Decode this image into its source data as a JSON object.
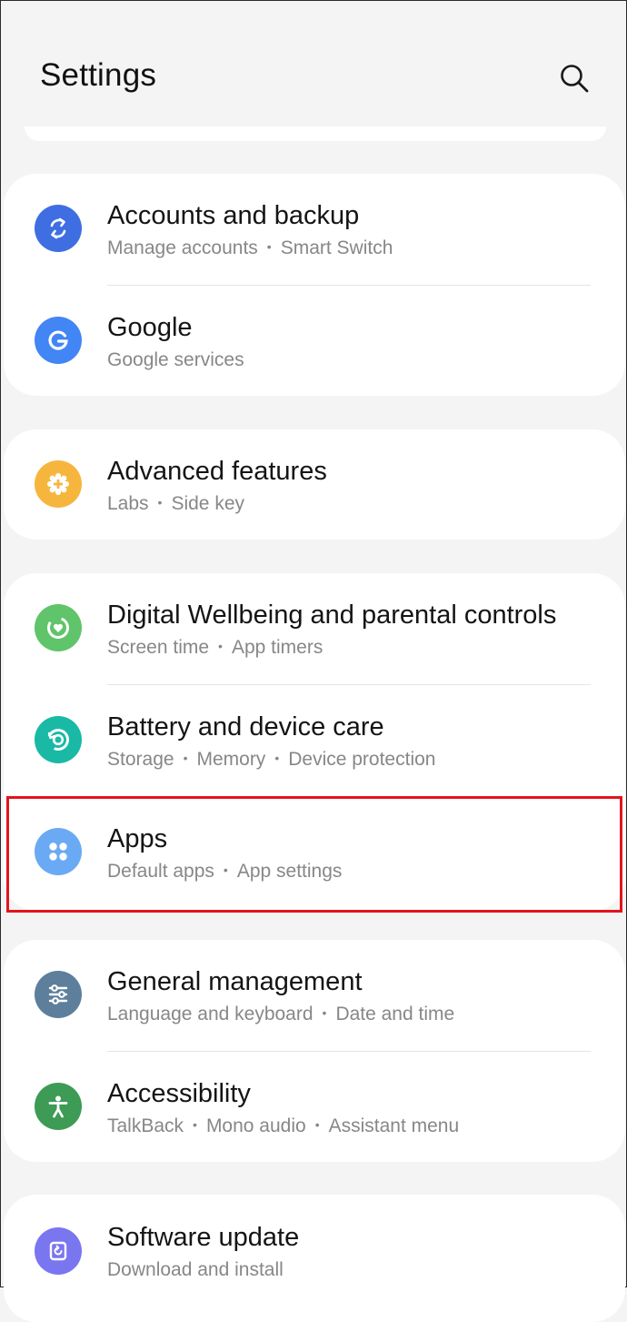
{
  "header": {
    "title": "Settings",
    "search_icon": "search-icon"
  },
  "groups": [
    {
      "items": [
        {
          "title": "Accounts and backup",
          "sub": [
            "Manage accounts",
            "Smart Switch"
          ],
          "icon": "sync-icon",
          "color": "#3f6ee2"
        },
        {
          "title": "Google",
          "sub": [
            "Google services"
          ],
          "icon": "google-g-icon",
          "color": "#4285f4"
        }
      ]
    },
    {
      "items": [
        {
          "title": "Advanced features",
          "sub": [
            "Labs",
            "Side key"
          ],
          "icon": "gear-plus-icon",
          "color": "#f6b63e"
        }
      ]
    },
    {
      "items": [
        {
          "title": "Digital Wellbeing and parental controls",
          "sub": [
            "Screen time",
            "App timers"
          ],
          "icon": "wellbeing-heart-icon",
          "color": "#5fc46a"
        },
        {
          "title": "Battery and device care",
          "sub": [
            "Storage",
            "Memory",
            "Device protection"
          ],
          "icon": "device-care-icon",
          "color": "#19b9a6"
        },
        {
          "title": "Apps",
          "sub": [
            "Default apps",
            "App settings"
          ],
          "icon": "apps-grid-icon",
          "color": "#6aaaf5"
        }
      ]
    },
    {
      "items": [
        {
          "title": "General management",
          "sub": [
            "Language and keyboard",
            "Date and time"
          ],
          "icon": "sliders-icon",
          "color": "#5d7f9c"
        },
        {
          "title": "Accessibility",
          "sub": [
            "TalkBack",
            "Mono audio",
            "Assistant menu"
          ],
          "icon": "accessibility-person-icon",
          "color": "#3d9b55"
        }
      ]
    },
    {
      "items": [
        {
          "title": "Software update",
          "sub": [
            "Download and install"
          ],
          "icon": "update-icon",
          "color": "#7a76f0"
        }
      ]
    }
  ],
  "highlight": {
    "color": "#e3141c"
  }
}
